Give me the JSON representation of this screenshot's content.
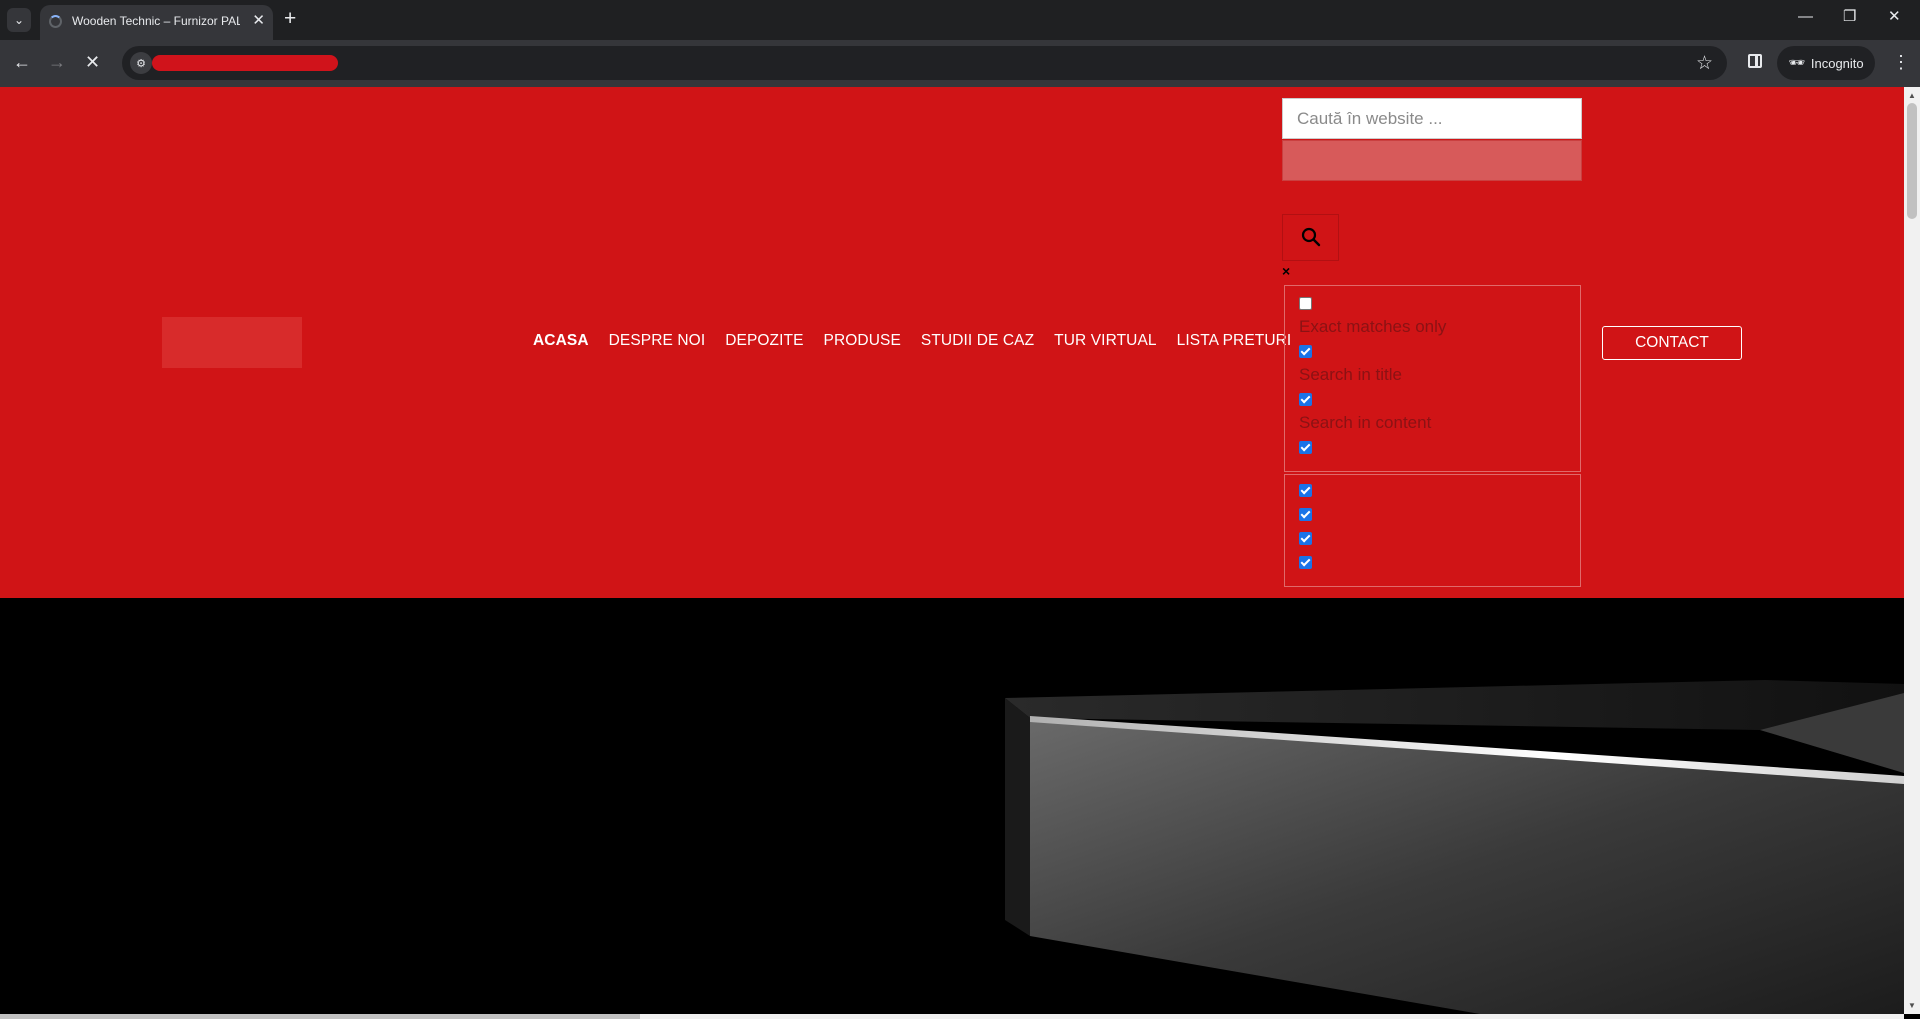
{
  "browser": {
    "tab_title": "Wooden Technic – Furnizor PAL",
    "tab_close": "✕",
    "new_tab": "+",
    "incognito_label": "Incognito"
  },
  "site": {
    "nav": [
      {
        "label": "ACASA",
        "active": true
      },
      {
        "label": "DESPRE NOI",
        "active": false
      },
      {
        "label": "DEPOZITE",
        "active": false
      },
      {
        "label": "PRODUSE",
        "active": false
      },
      {
        "label": "STUDII DE CAZ",
        "active": false
      },
      {
        "label": "TUR VIRTUAL",
        "active": false
      },
      {
        "label": "LISTA PRETURI",
        "active": false
      }
    ],
    "search": {
      "placeholder": "Caută în website ...",
      "close_symbol": "×"
    },
    "filters": {
      "group_1": [
        {
          "label": "Exact matches only",
          "checked": false
        },
        {
          "label": "Search in title",
          "checked": true
        },
        {
          "label": "Search in content",
          "checked": true
        },
        {
          "label": "",
          "checked": true
        }
      ],
      "group_2": [
        {
          "checked": true
        },
        {
          "checked": true
        },
        {
          "checked": true
        },
        {
          "checked": true
        }
      ]
    },
    "contact_label": "CONTACT"
  },
  "colors": {
    "header_red": "#d01416",
    "hero_background": "#000000",
    "chrome_dark": "#35363a"
  }
}
